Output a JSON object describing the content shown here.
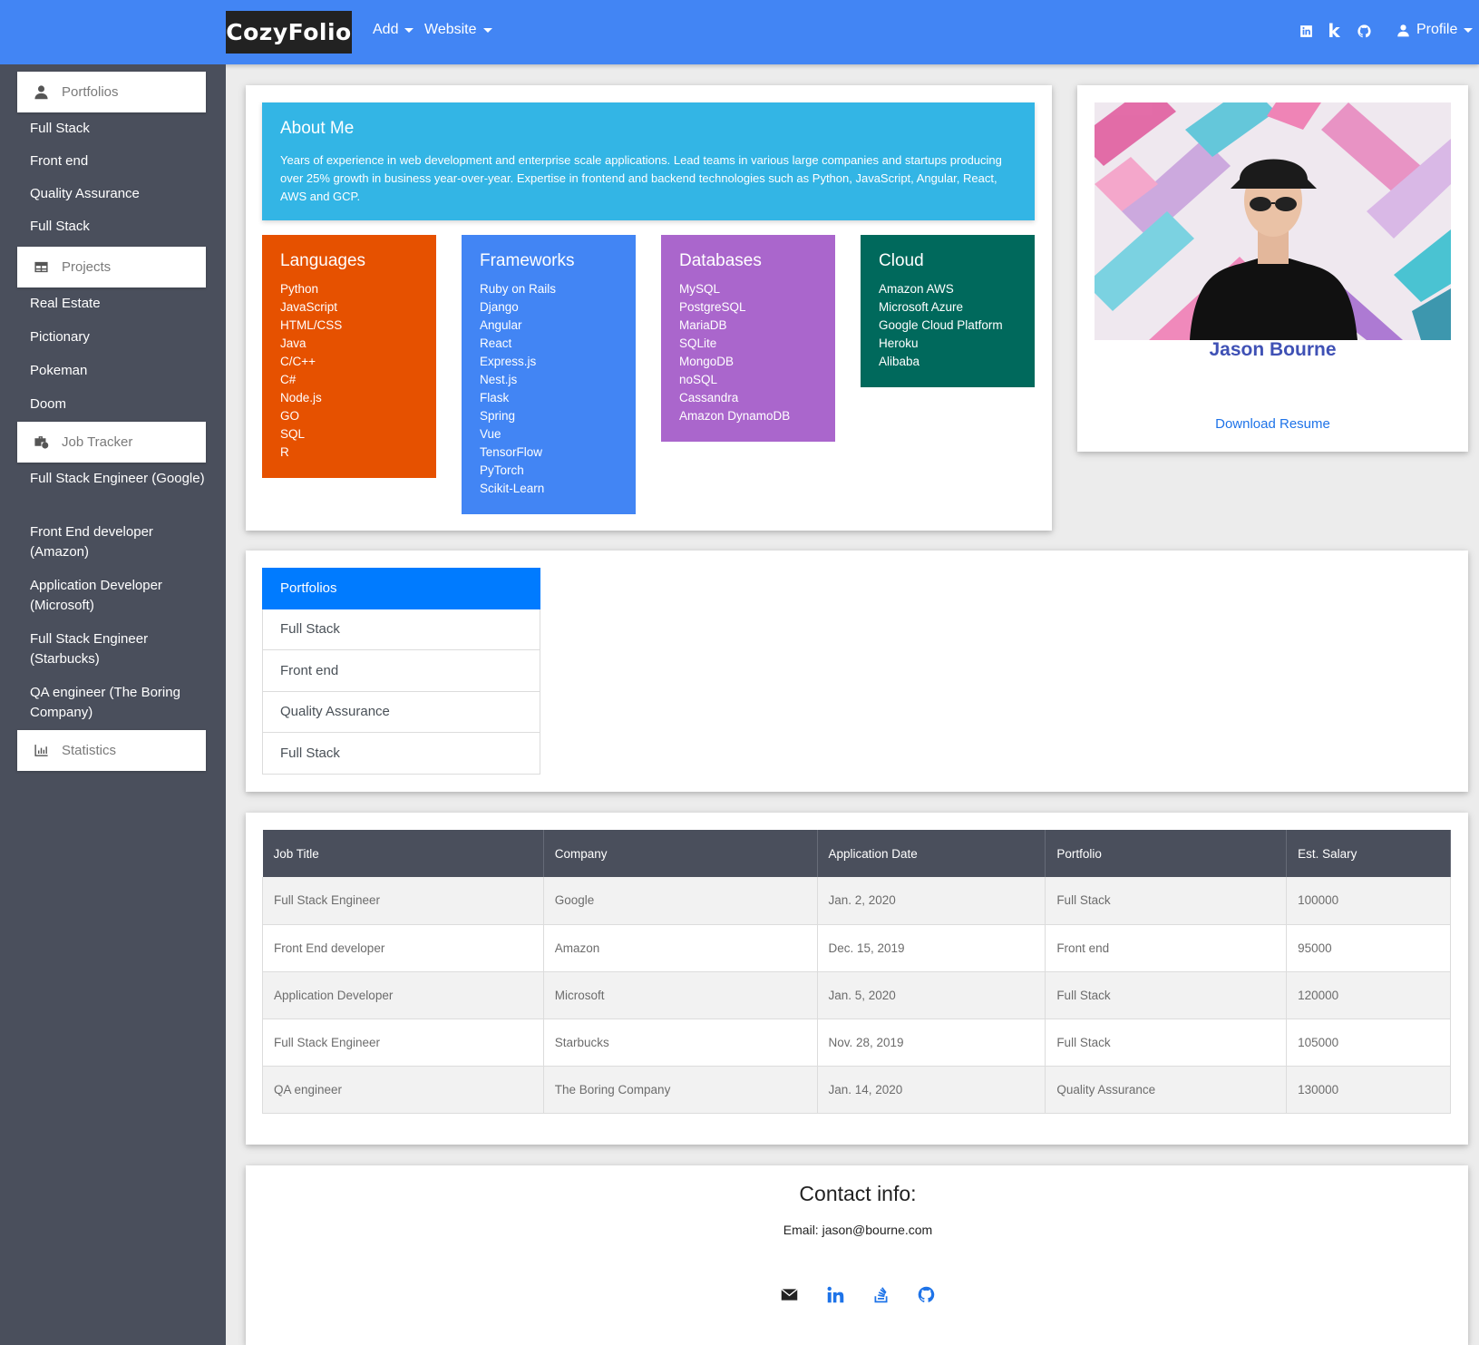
{
  "navbar": {
    "brand": "CozyFolio",
    "add_label": "Add",
    "website_label": "Website",
    "k_label": "k",
    "profile_label": "Profile"
  },
  "sidebar": {
    "portfolios": {
      "label": "Portfolios",
      "items": [
        "Full Stack",
        "Front end",
        "Quality Assurance",
        "Full Stack"
      ]
    },
    "projects": {
      "label": "Projects",
      "items": [
        "Real Estate",
        "Pictionary",
        "Pokeman",
        "Doom"
      ]
    },
    "job_tracker": {
      "label": "Job Tracker",
      "items": [
        "Full Stack Engineer (Google)",
        "Front End developer (Amazon)",
        "Application Developer (Microsoft)",
        "Full Stack Engineer (Starbucks)",
        "QA engineer (The Boring Company)"
      ]
    },
    "statistics": {
      "label": "Statistics"
    }
  },
  "about": {
    "title": "About Me",
    "text": "Years of experience in web development and enterprise scale applications. Lead teams in various large companies and startups producing over 25% growth in business year-over-year. Expertise in frontend and backend technologies such as Python, JavaScript, Angular, React, AWS and GCP."
  },
  "skills": [
    {
      "title": "Languages",
      "color": "#e65100",
      "items": [
        "Python",
        "JavaScript",
        "HTML/CSS",
        "Java",
        "C/C++",
        "C#",
        "Node.js",
        "GO",
        "SQL",
        "R"
      ]
    },
    {
      "title": "Frameworks",
      "color": "#4285f4",
      "items": [
        "Ruby on Rails",
        "Django",
        "Angular",
        "React",
        "Express.js",
        "Nest.js",
        "Flask",
        "Spring",
        "Vue",
        "TensorFlow",
        "PyTorch",
        "Scikit-Learn"
      ]
    },
    {
      "title": "Databases",
      "color": "#aa66cc",
      "items": [
        "MySQL",
        "PostgreSQL",
        "MariaDB",
        "SQLite",
        "MongoDB",
        "noSQL",
        "Cassandra",
        "Amazon DynamoDB"
      ]
    },
    {
      "title": "Cloud",
      "color": "#00695c",
      "items": [
        "Amazon AWS",
        "Microsoft Azure",
        "Google Cloud Platform",
        "Heroku",
        "Alibaba"
      ]
    }
  ],
  "profile": {
    "name": "Jason Bourne",
    "download_label": "Download Resume"
  },
  "portfolio_list": {
    "header": "Portfolios",
    "items": [
      "Full Stack",
      "Front end",
      "Quality Assurance",
      "Full Stack"
    ]
  },
  "jobs_table": {
    "headers": [
      "Job Title",
      "Company",
      "Application Date",
      "Portfolio",
      "Est. Salary"
    ],
    "rows": [
      [
        "Full Stack Engineer",
        "Google",
        "Jan. 2, 2020",
        "Full Stack",
        "100000"
      ],
      [
        "Front End developer",
        "Amazon",
        "Dec. 15, 2019",
        "Front end",
        "95000"
      ],
      [
        "Application Developer",
        "Microsoft",
        "Jan. 5, 2020",
        "Full Stack",
        "120000"
      ],
      [
        "Full Stack Engineer",
        "Starbucks",
        "Nov. 28, 2019",
        "Full Stack",
        "105000"
      ],
      [
        "QA engineer",
        "The Boring Company",
        "Jan. 14, 2020",
        "Quality Assurance",
        "130000"
      ]
    ]
  },
  "contact": {
    "title": "Contact info:",
    "email": "Email: jason@bourne.com",
    "icons": [
      "envelope-icon",
      "linkedin-icon",
      "stackoverflow-icon",
      "github-icon"
    ]
  },
  "colors": {
    "navbar": "#4285f4",
    "sidebar": "#4a4f5c",
    "about": "#33b5e5",
    "active": "#007bff",
    "name": "#3f51b5"
  }
}
